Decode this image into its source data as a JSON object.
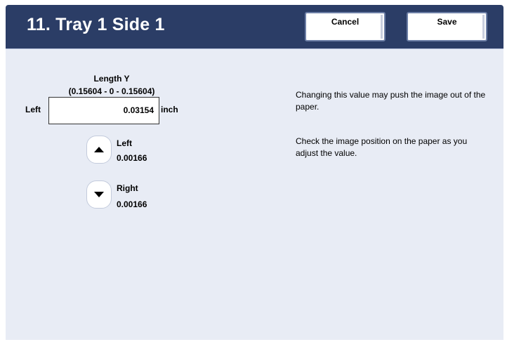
{
  "header": {
    "title": "11. Tray 1  Side 1",
    "cancel_label": "Cancel",
    "save_label": "Save"
  },
  "adjust": {
    "title": "Length Y",
    "range": "(0.15604 - 0 -  0.15604)",
    "side_label": "Left",
    "value": "0.03154",
    "unit": "inch",
    "up": {
      "label": "Left",
      "value": "0.00166"
    },
    "down": {
      "label": "Right",
      "value": "0.00166"
    }
  },
  "info": {
    "line1": "Changing this value may push the image out of the paper.",
    "line2": "Check the image position on the paper as you adjust the value."
  },
  "colors": {
    "header_bg": "#2b3d66",
    "panel_bg": "#e8ecf5",
    "button_border": "#6d7fa6"
  },
  "icons": {
    "up": "triangle-up-icon",
    "down": "triangle-down-icon"
  }
}
